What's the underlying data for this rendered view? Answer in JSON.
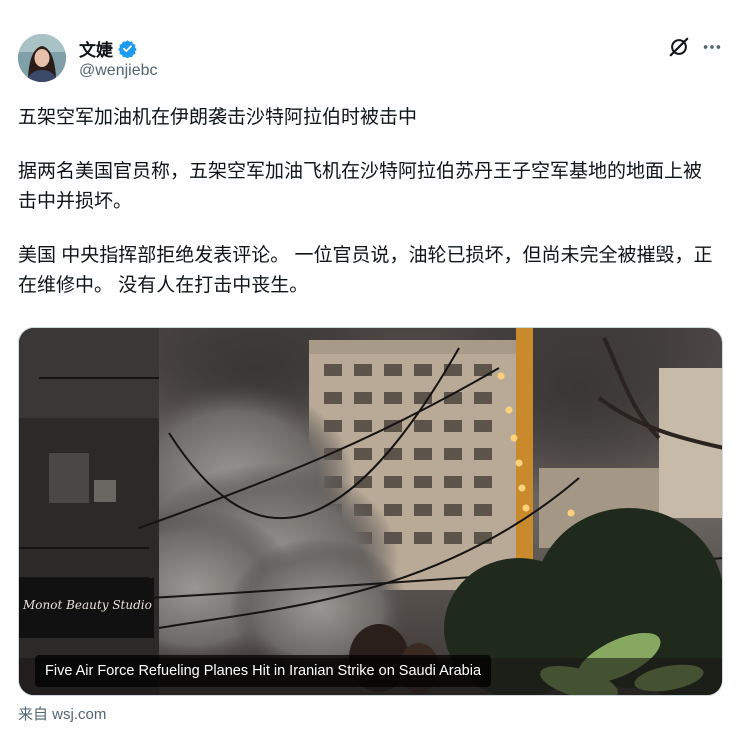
{
  "author": {
    "display_name": "文婕",
    "handle": "@wenjiebc",
    "verified_icon": "verified-badge-icon",
    "accent_color": "#1d9bf0"
  },
  "actions": {
    "grok_icon": "grok-icon",
    "more_icon": "more-horizontal-icon"
  },
  "tweet": {
    "paragraphs": [
      "五架空军加油机在伊朗袭击沙特阿拉伯时被击中",
      "据两名美国官员称，五架空军加油飞机在沙特阿拉伯苏丹王子空军基地的地面上被击中并损坏。",
      "美国 中央指挥部拒绝发表评论。 一位官员说，油轮已损坏，但尚未完全被摧毁，正在维修中。 没有人在打击中丧生。"
    ]
  },
  "media": {
    "caption": "Five Air Force Refueling Planes Hit in Iranian Strike on Saudi Arabia",
    "sign_text": "Monot Beauty Studio"
  },
  "source": {
    "text": "来自 wsj.com"
  }
}
